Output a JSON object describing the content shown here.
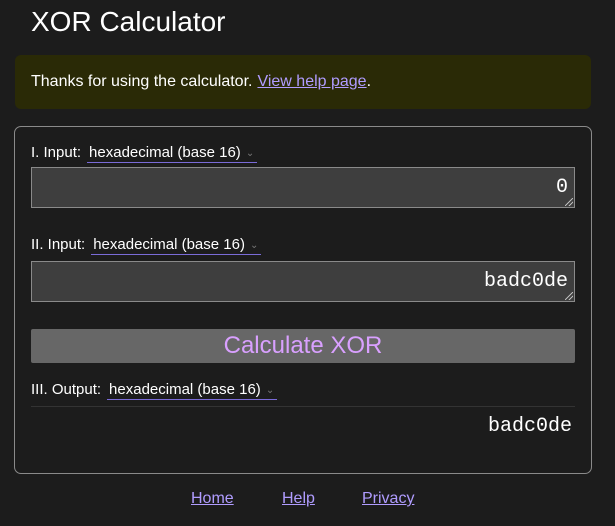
{
  "header": {
    "title": "XOR Calculator"
  },
  "notice": {
    "text": "Thanks for using the calculator.",
    "link_text": "View help page",
    "suffix": "."
  },
  "calculator": {
    "input1": {
      "label": "I. Input:",
      "format": "hexadecimal (base 16)",
      "value": "0"
    },
    "input2": {
      "label": "II. Input:",
      "format": "hexadecimal (base 16)",
      "value": "badc0de"
    },
    "calculate_label": "Calculate XOR",
    "output": {
      "label": "III. Output:",
      "format": "hexadecimal (base 16)",
      "value": "badc0de"
    }
  },
  "footer": {
    "links": [
      "Home",
      "Help",
      "Privacy"
    ]
  },
  "colors": {
    "background": "#1c1c1c",
    "notice_bg": "#2a2a06",
    "link": "#b09cff",
    "button_bg": "#676767",
    "button_text": "#d9a0ff",
    "input_bg": "#3e3e3e"
  }
}
